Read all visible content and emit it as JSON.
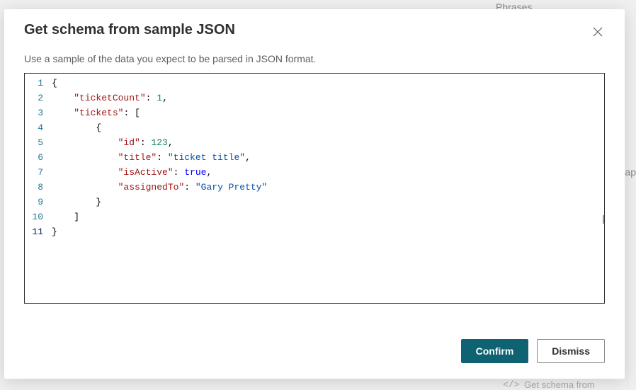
{
  "bg": {
    "phrases": "Phrases",
    "ap": "ap",
    "getSchema": "Get schema from"
  },
  "dialog": {
    "title": "Get schema from sample JSON",
    "subtitle": "Use a sample of the data you expect to be parsed in JSON format.",
    "closeLabel": "Close"
  },
  "editor": {
    "lineNumbers": [
      "1",
      "2",
      "3",
      "4",
      "5",
      "6",
      "7",
      "8",
      "9",
      "10",
      "11"
    ],
    "code": {
      "key_ticketCount": "\"ticketCount\"",
      "val_ticketCount": "1",
      "key_tickets": "\"tickets\"",
      "key_id": "\"id\"",
      "val_id": "123",
      "key_title": "\"title\"",
      "val_title": "\"ticket title\"",
      "key_isActive": "\"isActive\"",
      "val_isActive": "true",
      "key_assignedTo": "\"assignedTo\"",
      "val_assignedTo": "\"Gary Pretty\""
    }
  },
  "footer": {
    "confirm": "Confirm",
    "dismiss": "Dismiss"
  }
}
